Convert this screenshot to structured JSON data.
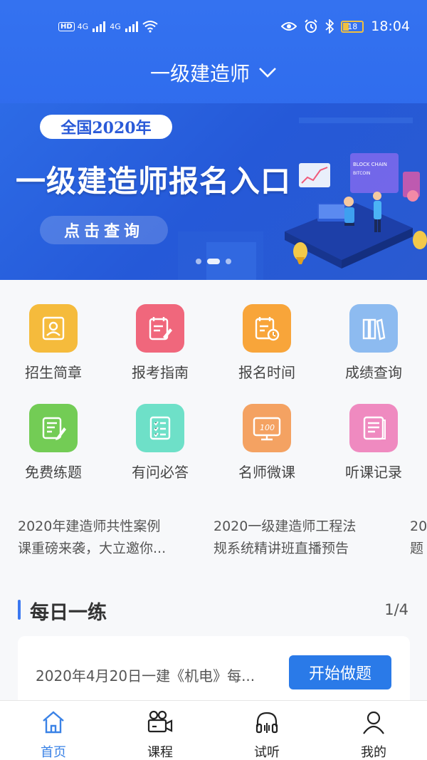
{
  "status_bar": {
    "network_hd": "HD",
    "sim_1": "4G",
    "sim_2": "4G",
    "battery": "18",
    "time": "18:04"
  },
  "header": {
    "title": "一级建造师"
  },
  "banner": {
    "pill": "全国2020年",
    "headline": "一级建造师报名入口",
    "button": "点击查询",
    "art_sign_1": "BLOCK CHAIN",
    "art_sign_2": "BITCOIN"
  },
  "grid": [
    {
      "label": "招生简章",
      "icon": "profile-card-icon",
      "color": "#f5bb3c"
    },
    {
      "label": "报考指南",
      "icon": "guide-edit-icon",
      "color": "#f0677c"
    },
    {
      "label": "报名时间",
      "icon": "calendar-clock-icon",
      "color": "#f8a53a"
    },
    {
      "label": "成绩查询",
      "icon": "books-icon",
      "color": "#8dbbf0"
    },
    {
      "label": "免费练题",
      "icon": "note-pen-icon",
      "color": "#73cc55"
    },
    {
      "label": "有问必答",
      "icon": "checklist-icon",
      "color": "#6ee0c8"
    },
    {
      "label": "名师微课",
      "icon": "monitor-icon",
      "color": "#f4a262"
    },
    {
      "label": "听课记录",
      "icon": "notebook-icon",
      "color": "#ef8ac0"
    }
  ],
  "grid_icon_text": {
    "monitor": "100"
  },
  "news": [
    {
      "line1": "2020年建造师共性案例",
      "line2": "课重磅来袭，大立邀你..."
    },
    {
      "line1": "2020一级建造师工程法",
      "line2": "规系统精讲班直播预告"
    },
    {
      "line1": "20",
      "line2": "题"
    }
  ],
  "daily": {
    "title": "每日一练",
    "count": "1/4",
    "item_text": "2020年4月20日一建《机电》每...",
    "button": "开始做题"
  },
  "tabs": [
    {
      "label": "首页",
      "icon": "home-icon",
      "active": true
    },
    {
      "label": "课程",
      "icon": "video-camera-icon",
      "active": false
    },
    {
      "label": "试听",
      "icon": "headphones-icon",
      "active": false
    },
    {
      "label": "我的",
      "icon": "user-icon",
      "active": false
    }
  ],
  "colors": {
    "header_blue": "#3472f0",
    "accent": "#2a7ae8",
    "tab_active": "#3a82e6"
  }
}
